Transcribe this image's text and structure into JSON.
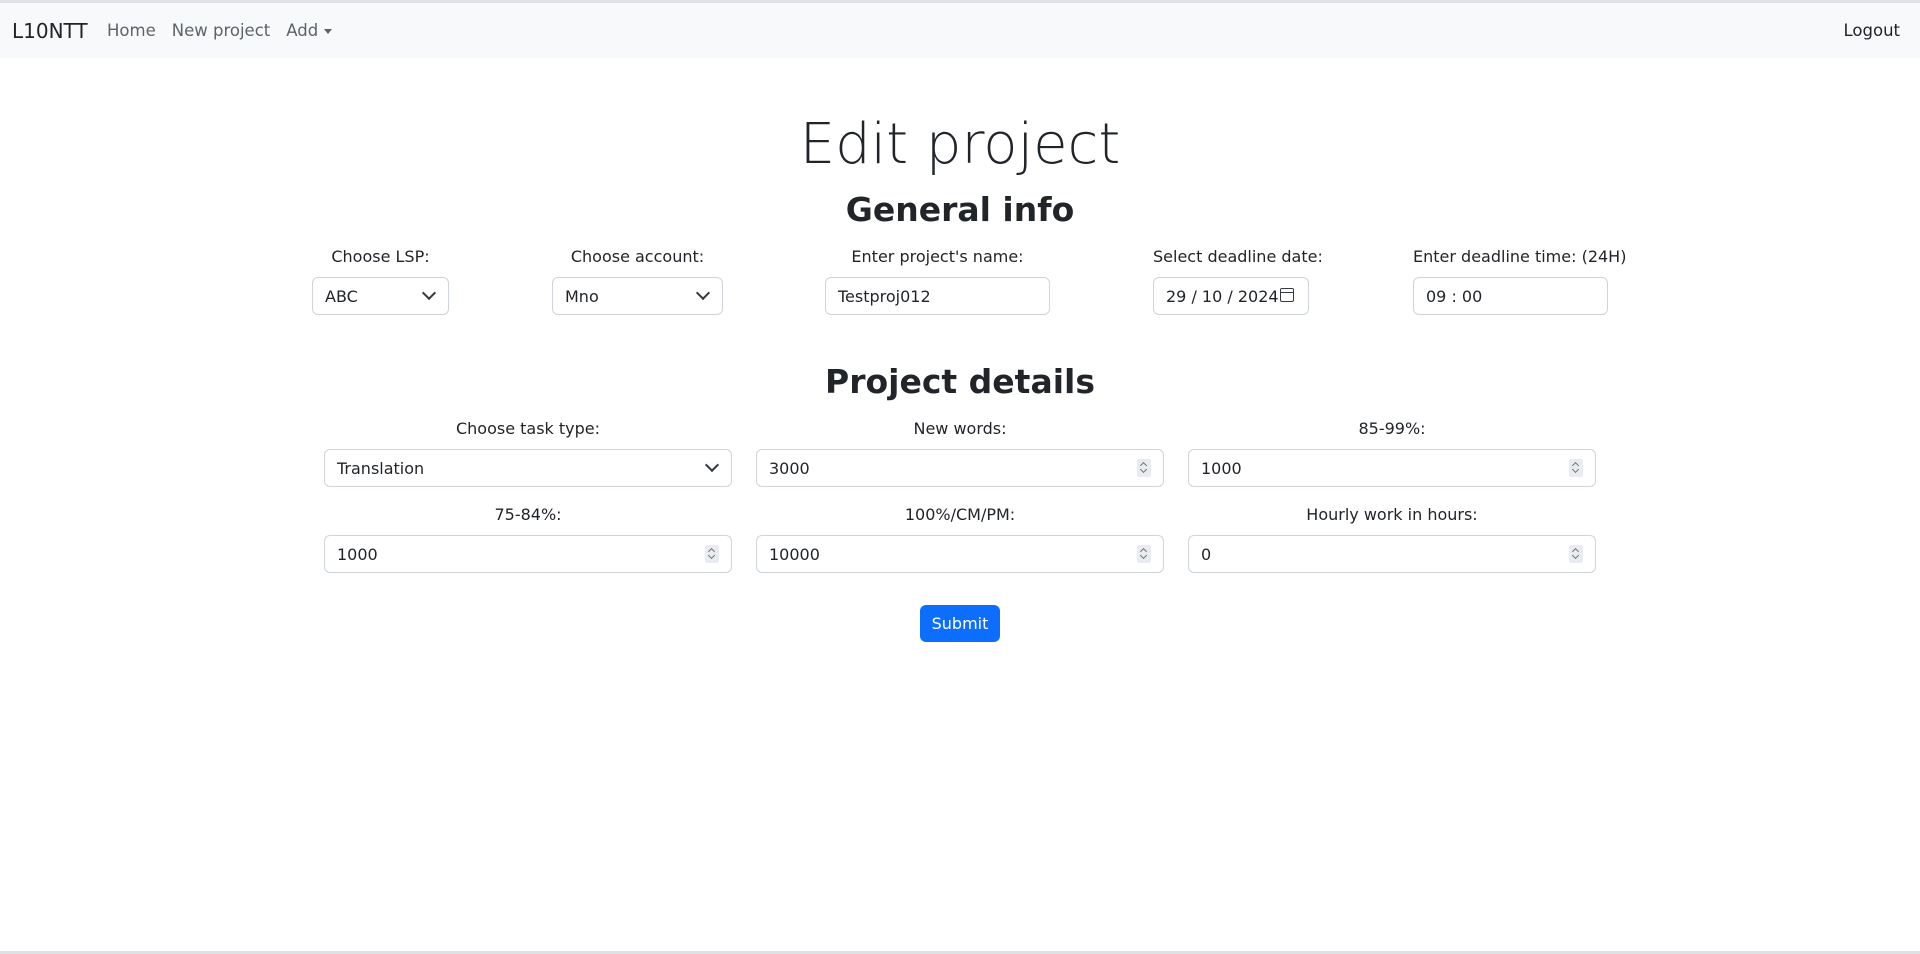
{
  "navbar": {
    "brand": "L10NTT",
    "links": [
      "Home",
      "New project"
    ],
    "add_label": "Add",
    "logout": "Logout"
  },
  "page_title": "Edit project",
  "general_info": {
    "title": "General info",
    "lsp": {
      "label": "Choose LSP:",
      "value": "ABC"
    },
    "account": {
      "label": "Choose account:",
      "value": "Mno"
    },
    "project_name": {
      "label": "Enter project's name:",
      "value": "Testproj012"
    },
    "deadline_date": {
      "label": "Select deadline date:",
      "value": "29 / 10 / 2024"
    },
    "deadline_time": {
      "label": "Enter deadline time: (24H)",
      "value": "09 : 00"
    }
  },
  "project_details": {
    "title": "Project details",
    "task_type": {
      "label": "Choose task type:",
      "value": "Translation"
    },
    "new_words": {
      "label": "New words:",
      "value": "3000"
    },
    "fuzzy_85_99": {
      "label": "85-99%:",
      "value": "1000"
    },
    "fuzzy_75_84": {
      "label": "75-84%:",
      "value": "1000"
    },
    "match_100": {
      "label": "100%/CM/PM:",
      "value": "10000"
    },
    "hourly": {
      "label": "Hourly work in hours:",
      "value": "0"
    }
  },
  "submit_label": "Submit",
  "colors": {
    "accent": "#0d6efd",
    "navbar_bg": "#f8f9fa",
    "border": "#ced4da"
  }
}
